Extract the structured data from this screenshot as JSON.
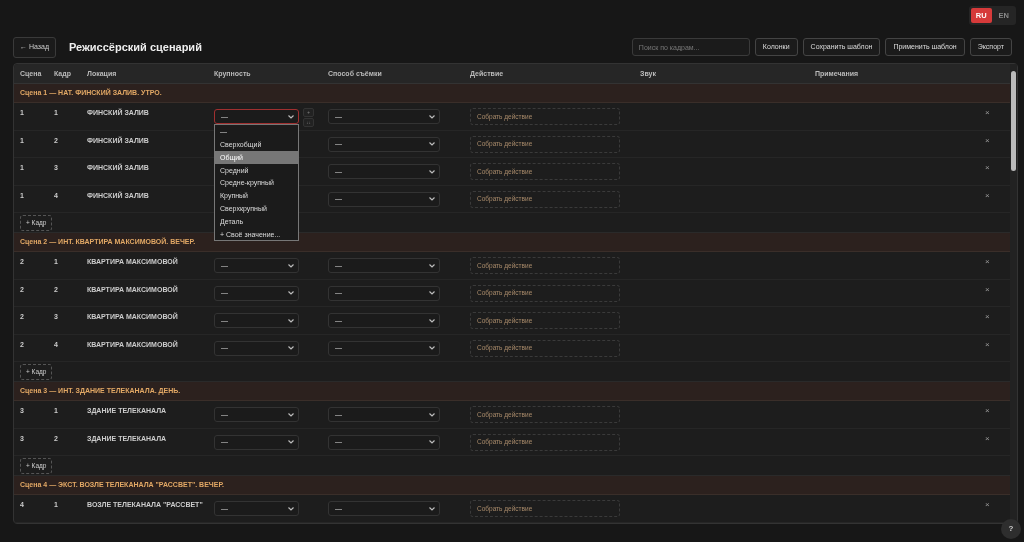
{
  "languages": [
    {
      "label": "RU",
      "selected": true
    },
    {
      "label": "EN",
      "selected": false
    }
  ],
  "back_button": "← Назад",
  "title": "Режиссёрский сценарий",
  "search": {
    "placeholder": "Поиск по кадрам..."
  },
  "toolbar_buttons": [
    "Колонки",
    "Сохранить шаблон",
    "Применить шаблон",
    "Экспорт"
  ],
  "columns": [
    "Сцена",
    "Кадр",
    "Локация",
    "Крупность",
    "Способ съёмки",
    "Действие",
    "Звук",
    "Примечания"
  ],
  "scenes": [
    {
      "heading": "Сцена 1 — НАТ. ФИНСКИЙ ЗАЛИВ. УТРО.",
      "add_button": "+ Кадр",
      "rows": [
        {
          "scene": "1",
          "shot": "1",
          "location": "ФИНСКИЙ ЗАЛИВ",
          "size": {
            "value": "—",
            "open": true,
            "options": [
              {
                "label": "—",
                "highlighted": false
              },
              {
                "label": "Сверхобщий",
                "highlighted": false
              },
              {
                "label": "Общий",
                "highlighted": true
              },
              {
                "label": "Средний",
                "highlighted": false
              },
              {
                "label": "Средне-крупный",
                "highlighted": false
              },
              {
                "label": "Крупный",
                "highlighted": false
              },
              {
                "label": "Сверхкрупный",
                "highlighted": false
              },
              {
                "label": "Деталь",
                "highlighted": false
              },
              {
                "label": "+ Своё значение...",
                "highlighted": false
              }
            ]
          },
          "tools": [
            "+",
            "↓↓"
          ],
          "method": "—",
          "action_placeholder": "Собрать действие",
          "delete": "×"
        },
        {
          "scene": "1",
          "shot": "2",
          "location": "ФИНСКИЙ ЗАЛИВ",
          "method": "—",
          "action_placeholder": "Собрать действие",
          "delete": "×"
        },
        {
          "scene": "1",
          "shot": "3",
          "location": "ФИНСКИЙ ЗАЛИВ",
          "method": "—",
          "action_placeholder": "Собрать действие",
          "delete": "×"
        },
        {
          "scene": "1",
          "shot": "4",
          "location": "ФИНСКИЙ ЗАЛИВ",
          "method": "—",
          "action_placeholder": "Собрать действие",
          "delete": "×"
        }
      ]
    },
    {
      "heading": "Сцена 2 — ИНТ. КВАРТИРА МАКСИМОВОЙ. ВЕЧЕР.",
      "add_button": "+ Кадр",
      "rows": [
        {
          "scene": "2",
          "shot": "1",
          "location": "КВАРТИРА МАКСИМОВОЙ",
          "size": {
            "value": "—",
            "open": false
          },
          "method": "—",
          "action_placeholder": "Собрать действие",
          "delete": "×"
        },
        {
          "scene": "2",
          "shot": "2",
          "location": "КВАРТИРА МАКСИМОВОЙ",
          "size": {
            "value": "—",
            "open": false
          },
          "method": "—",
          "action_placeholder": "Собрать действие",
          "delete": "×"
        },
        {
          "scene": "2",
          "shot": "3",
          "location": "КВАРТИРА МАКСИМОВОЙ",
          "size": {
            "value": "—",
            "open": false
          },
          "method": "—",
          "action_placeholder": "Собрать действие",
          "delete": "×"
        },
        {
          "scene": "2",
          "shot": "4",
          "location": "КВАРТИРА МАКСИМОВОЙ",
          "size": {
            "value": "—",
            "open": false
          },
          "method": "—",
          "action_placeholder": "Собрать действие",
          "delete": "×"
        }
      ]
    },
    {
      "heading": "Сцена 3 — ИНТ. ЗДАНИЕ ТЕЛЕКАНАЛА. ДЕНЬ.",
      "add_button": "+ Кадр",
      "rows": [
        {
          "scene": "3",
          "shot": "1",
          "location": "ЗДАНИЕ ТЕЛЕКАНАЛА",
          "size": {
            "value": "—",
            "open": false
          },
          "method": "—",
          "action_placeholder": "Собрать действие",
          "delete": "×"
        },
        {
          "scene": "3",
          "shot": "2",
          "location": "ЗДАНИЕ ТЕЛЕКАНАЛА",
          "size": {
            "value": "—",
            "open": false
          },
          "method": "—",
          "action_placeholder": "Собрать действие",
          "delete": "×"
        }
      ]
    },
    {
      "heading": "Сцена 4 — ЭКСТ. ВОЗЛЕ ТЕЛЕКАНАЛА \"РАССВЕТ\". ВЕЧЕР.",
      "rows": [
        {
          "scene": "4",
          "shot": "1",
          "location": "ВОЗЛЕ ТЕЛЕКАНАЛА \"РАССВЕТ\"",
          "size": {
            "value": "—",
            "open": false
          },
          "method": "—",
          "action_placeholder": "Собрать действие",
          "delete": "×"
        }
      ]
    }
  ],
  "help_button": "?"
}
